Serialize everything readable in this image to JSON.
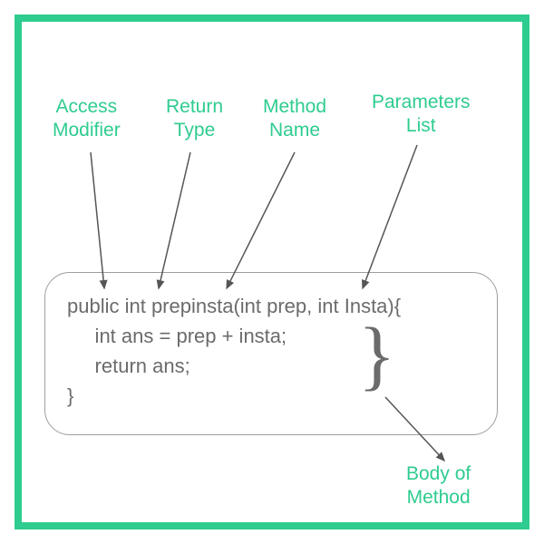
{
  "labels": {
    "access_modifier": "Access\nModifier",
    "return_type": "Return\nType",
    "method_name": "Method\nName",
    "parameters_list": "Parameters\nList",
    "body_of_method": "Body of\nMethod"
  },
  "code": {
    "line1": "public int prepinsta(int prep, int Insta){",
    "line2": "     int ans = prep + insta;",
    "line3": "     return ans;",
    "line4": "}"
  },
  "brace": "}",
  "colors": {
    "accent": "#2ecc8f",
    "text": "#6b6b6b",
    "border": "#9e9e9e"
  }
}
